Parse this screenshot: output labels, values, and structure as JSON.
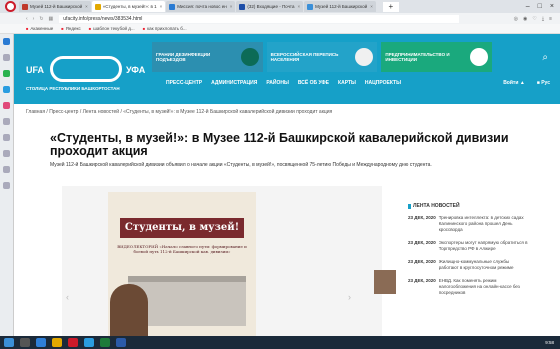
{
  "tabs": [
    {
      "label": "Музей 112-й Башкирской"
    },
    {
      "label": "«Студенты, в музей!»: в 1"
    },
    {
      "label": "Миссия: почта новос ен"
    },
    {
      "label": "(32) Входящие - Почта"
    },
    {
      "label": "Музей 112-й Башкирской"
    }
  ],
  "address": {
    "url": "ufacity.info/press/news/383534.html"
  },
  "bookmarks": [
    "Акакенные",
    "Яндекс",
    "шаблон текубой д...",
    "как прихлопать б..."
  ],
  "header": {
    "logo_left": "UFA",
    "logo_right": "УФА",
    "logo_caption": "СТОЛИЦА РЕСПУБЛИКИ БАШКОРТОСТАН",
    "banners": [
      "ГРАНИИ ДЕЗИНФЕКЦИИ ПОДЪЕЗДОВ",
      "ВСЕРОССИЙСКАЯ ПЕРЕПИСЬ НАСЕЛЕНИЯ",
      "ПРЕДПРИНИМАТЕЛЬСТВО И ИНВЕСТИЦИИ"
    ],
    "menu": [
      "ПРЕСС-ЦЕНТР",
      "АДМИНИСТРАЦИЯ",
      "РАЙОНЫ",
      "ВСЁ ОБ УФЕ",
      "КАРТЫ",
      "НАЦПРОЕКТЫ"
    ],
    "login": "Войти",
    "lang": "Рус"
  },
  "breadcrumbs": "Главная / Пресс-центр / Лента новостей / «Студенты, в музей!»: в Музее 112-й Башкирской кавалерийской дивизии проходит акция",
  "article": {
    "title": "«Студенты, в музей!»: в Музее 112-й Башкирской кавалерийской дивизии проходит акция",
    "lead": "Музей 112-й Башкирской кавалерийской дивизии объявил о начале акции «Студенты, в музей!», посвященной 75-летию Победы и Международному дню студента.",
    "poster_title": "Студенты, в музей!",
    "poster_text": "ВИДЕОЛЕКТОРИЙ «Начало славного пути: формирование и боевой путь 112-й Башкирской кав. дивизии»"
  },
  "news": {
    "heading": "ЛЕНТА НОВОСТЕЙ",
    "items": [
      {
        "date": "23 ДЕК, 2020",
        "text": "Тренировка интеллекта: в детских садах Калининского района прошел День кроссворда"
      },
      {
        "date": "23 ДЕК, 2020",
        "text": "Экспортеры могут напрямую обратиться в Торгпредство РФ в Алжире"
      },
      {
        "date": "23 ДЕК, 2020",
        "text": "Жилищно-коммунальные службы работают в круглосуточном режиме"
      },
      {
        "date": "23 ДЕК, 2020",
        "text": "ЕНВД. Как поменять режим налогообложения на онлайн-кассе без посредников"
      }
    ]
  },
  "taskbar": {
    "time": "9:58"
  },
  "colors": {
    "header": "#16a0c8",
    "accent": "#1fb08e",
    "poster_title": "#7a2a2e"
  }
}
